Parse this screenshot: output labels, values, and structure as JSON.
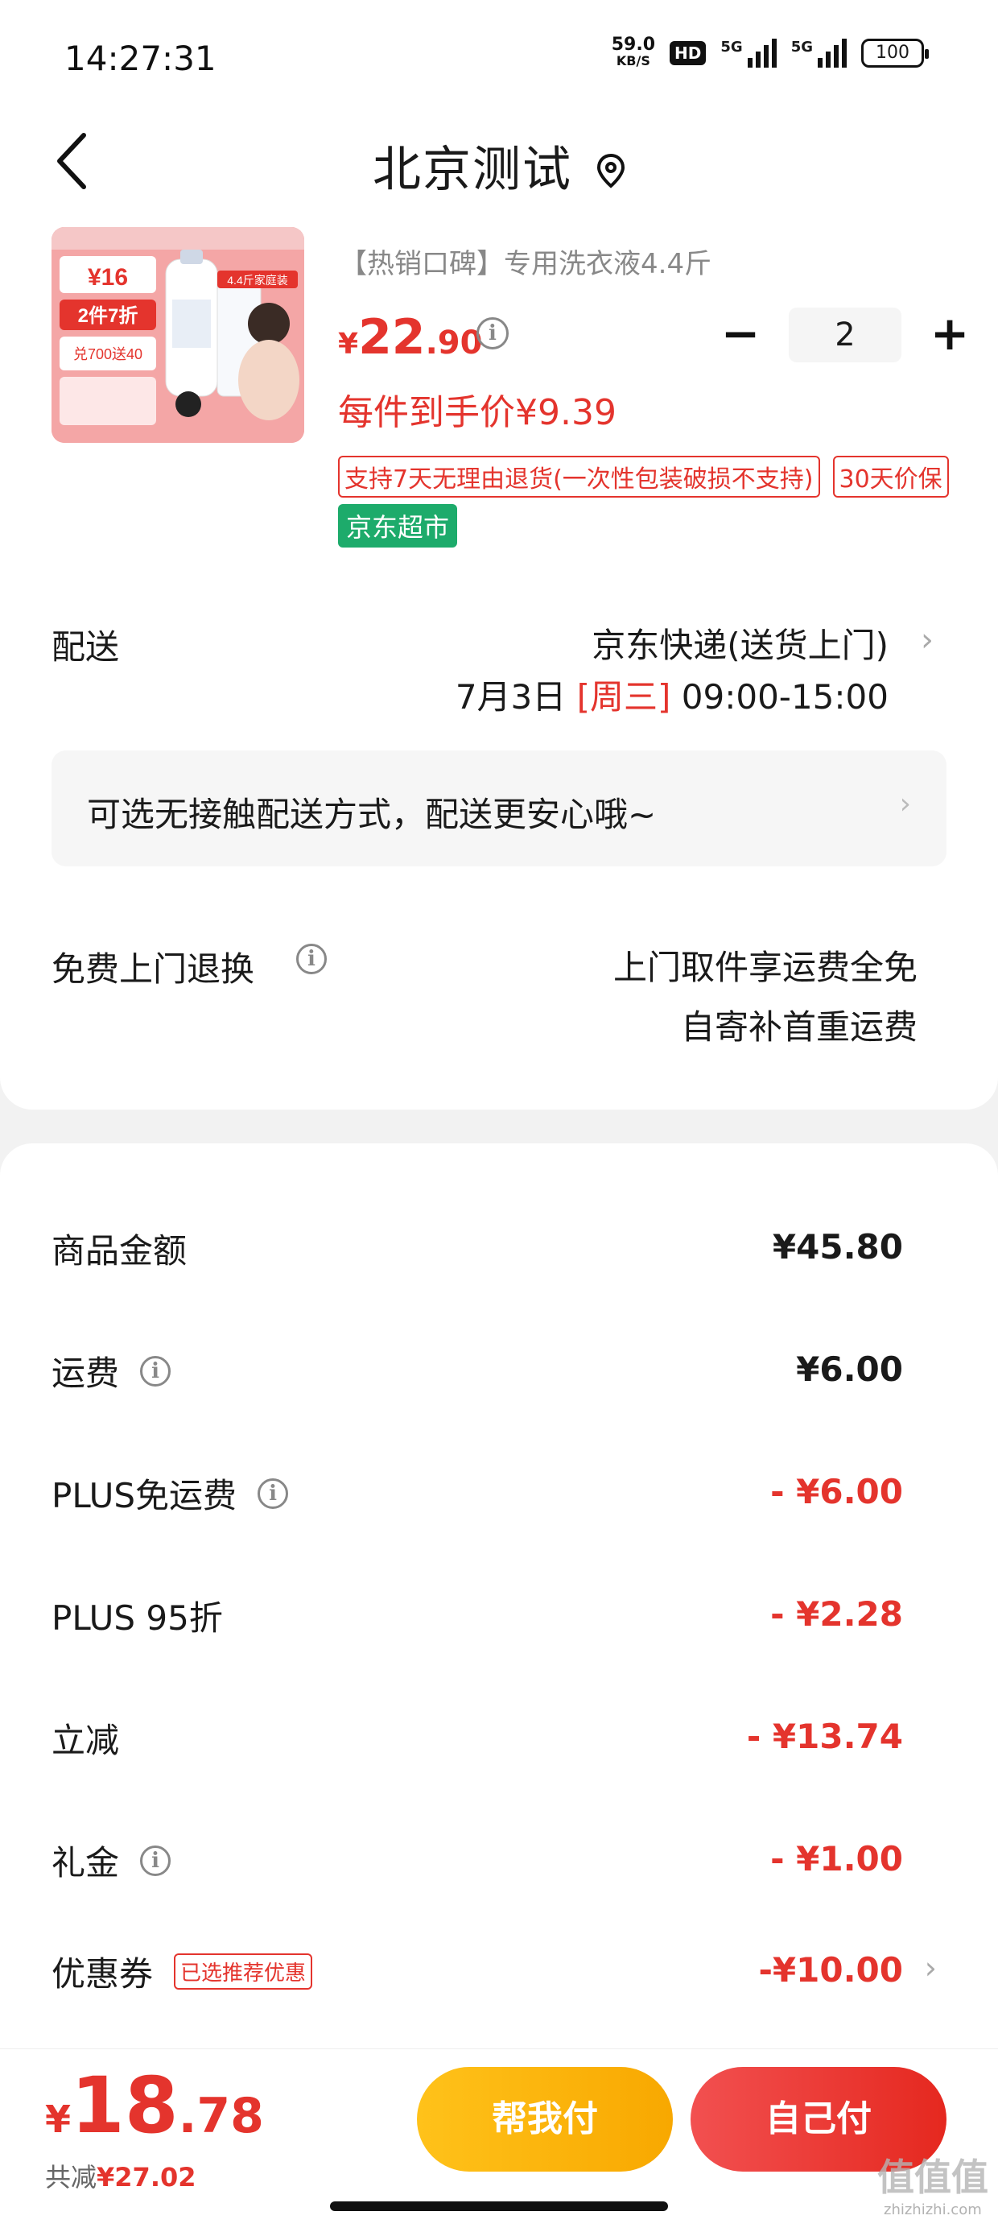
{
  "status_bar": {
    "time": "14:27:31",
    "net_speed_value": "59.0",
    "net_speed_unit": "KB/S",
    "hd": "HD",
    "signal1": "5G",
    "signal2": "5G",
    "battery": "100"
  },
  "header": {
    "title": "北京测试"
  },
  "product": {
    "subtitle": "【热销口碑】专用洗衣液4.4斤",
    "price_symbol": "¥",
    "price_int": "22",
    "price_dec": ".90",
    "quantity": "2",
    "unit_price": "每件到手价¥9.39",
    "tags": [
      "支持7天无理由退货(一次性包装破损不支持)",
      "30天价保"
    ],
    "store_tag": "京东超市",
    "image_texts": {
      "promo_price": "¥16",
      "discount": "2件7折",
      "gift": "兑700送40",
      "family_pack": "4.4斤家庭装"
    }
  },
  "delivery": {
    "label": "配送",
    "method": "京东快递(送货上门)",
    "date": "7月3日",
    "weekday": "[周三]",
    "time": "09:00-15:00"
  },
  "contactless": {
    "text": "可选无接触配送方式，配送更安心哦~"
  },
  "returns": {
    "label": "免费上门退换",
    "line1": "上门取件享运费全免",
    "line2": "自寄补首重运费"
  },
  "fees": {
    "goods_label": "商品金额",
    "goods_value": "¥45.80",
    "shipping_label": "运费",
    "shipping_value": "¥6.00",
    "plus_free_label": "PLUS免运费",
    "plus_free_value": "- ¥6.00",
    "plus_discount_label": "PLUS 95折",
    "plus_discount_value": "- ¥2.28",
    "instant_label": "立减",
    "instant_value": "- ¥13.74",
    "gift_label": "礼金",
    "gift_value": "- ¥1.00",
    "coupon_label": "优惠券",
    "coupon_tag": "已选推荐优惠",
    "coupon_value": "-¥10.00"
  },
  "bottom": {
    "total_symbol": "¥",
    "total_int": "18",
    "total_dec": ".78",
    "saved_label": "共减",
    "saved_amount": "¥27.02",
    "help_pay": "帮我付",
    "self_pay": "自己付"
  },
  "watermark": {
    "main": "值值值",
    "sub": "zhizhizhi.com"
  },
  "colors": {
    "accent_red": "#e4342d",
    "green_tag": "#1dab6b",
    "yellow_button": "#ffc21a"
  }
}
